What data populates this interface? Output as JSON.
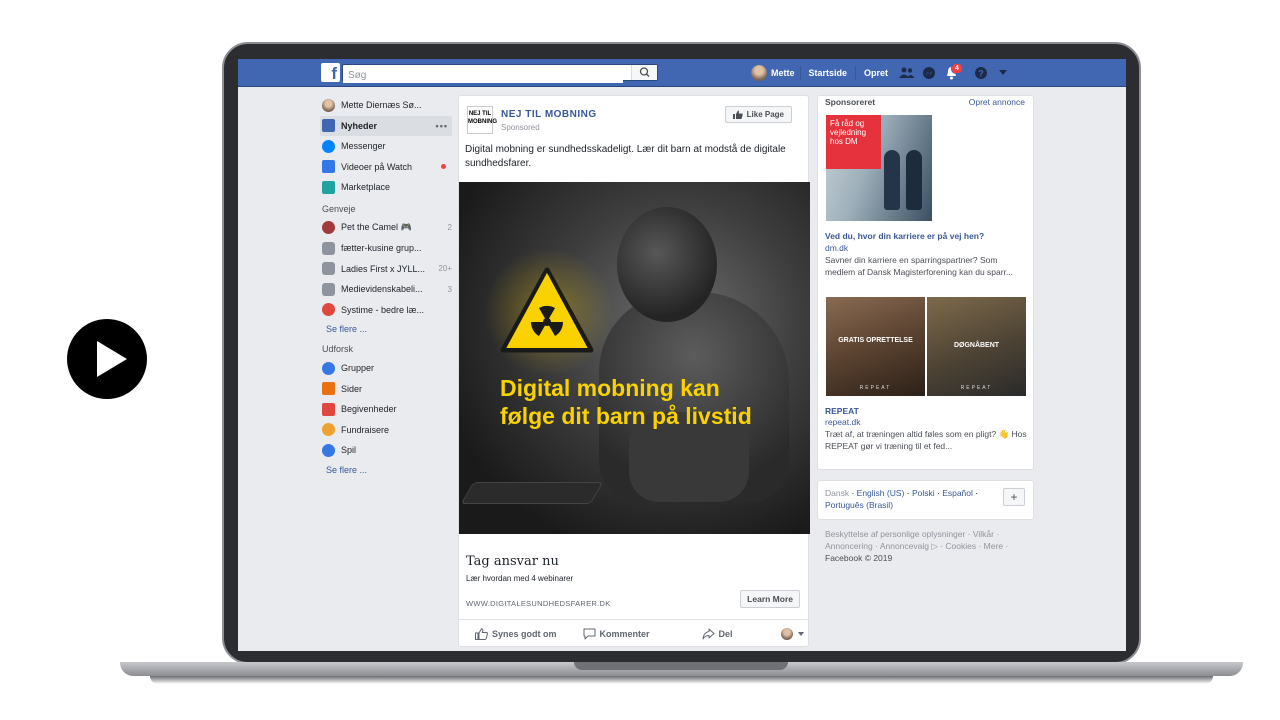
{
  "search": {
    "placeholder": "Søg"
  },
  "topbar": {
    "user_name": "Mette",
    "home": "Startside",
    "create": "Opret",
    "notif_count": "4"
  },
  "leftnav": {
    "profile": "Mette Diernæs Sø...",
    "main_items": [
      {
        "label": "Nyheder",
        "color": "#4267b2"
      },
      {
        "label": "Messenger",
        "color": "#0084ff"
      },
      {
        "label": "Videoer på Watch",
        "color": "#3578e5"
      },
      {
        "label": "Marketplace",
        "color": "#20a39e"
      }
    ],
    "more_dots": "•••",
    "shortcuts_head": "Genveje",
    "shortcuts": [
      {
        "label": "Pet the Camel 🎮",
        "count": "2",
        "color": "#a33a3a"
      },
      {
        "label": "fætter-kusine grup...",
        "count": "",
        "color": "#8d949e"
      },
      {
        "label": "Ladies First x JYLL...",
        "count": "20+",
        "color": "#8d949e"
      },
      {
        "label": "Medievidenskabeli...",
        "count": "3",
        "color": "#8d949e"
      },
      {
        "label": "Systime - bedre læ...",
        "count": "",
        "color": "#e0483f"
      }
    ],
    "see_more_1": "Se flere ...",
    "explore_head": "Udforsk",
    "explore": [
      {
        "label": "Grupper",
        "color": "#3578e5"
      },
      {
        "label": "Sider",
        "color": "#e9710f"
      },
      {
        "label": "Begivenheder",
        "color": "#e0483f"
      },
      {
        "label": "Fundraisere",
        "color": "#f0a22e"
      },
      {
        "label": "Spil",
        "color": "#3578e5"
      }
    ],
    "see_more_2": "Se flere ..."
  },
  "post": {
    "page_logo": "NEJ TIL MOBNING",
    "page_name": "NEJ TIL MOBNING",
    "sponsored": "Sponsored",
    "like_page": "Like Page",
    "text": "Digital mobning er sundhedsskadeligt. Lær dit barn at modstå de digitale sundhedsfarer.",
    "ad_headline": "Digital mobning kan følge dit barn på livstid",
    "cta_title": "Tag ansvar nu",
    "cta_sub": "Lær hvordan med 4 webinarer",
    "cta_url": "WWW.DIGITALESUNDHEDSFARER.DK",
    "learn_more": "Learn More",
    "like": "Synes godt om",
    "comment": "Kommenter",
    "share": "Del",
    "accent": "#fad200"
  },
  "sponsored": {
    "head": "Sponsoreret",
    "create_ad": "Opret annonce",
    "ad1": {
      "img_text": "Få råd og vejledning hos DM",
      "title": "Ved du, hvor din karriere er på vej hen?",
      "domain": "dm.dk",
      "body": "Savner din karriere en sparringspartner? Som medlem af Dansk Magisterforening kan du sparr..."
    },
    "ad2": {
      "img1_caption": "GRATIS OPRETTELSE",
      "img2_caption": "DØGNÅBENT",
      "brand_mark": "REPEAT",
      "title": "REPEAT",
      "domain": "repeat.dk",
      "body": "Træt af, at træningen altid føles som en pligt? 👋 Hos REPEAT gør vi træning til et fed..."
    }
  },
  "languages": {
    "current": "Dansk",
    "items": [
      "English (US)",
      "Polski",
      "Español",
      "Português (Brasil)"
    ],
    "add": "+"
  },
  "footer": {
    "links": "Beskyttelse af personlige oplysninger · Vilkår · Annoncering · Annoncevalg ▷ · Cookies · Mere ·",
    "copyright": "Facebook © 2019"
  }
}
